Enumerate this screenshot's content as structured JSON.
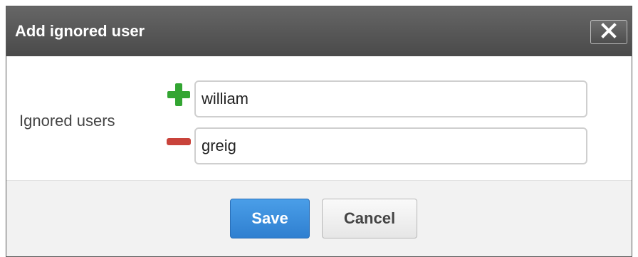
{
  "dialog": {
    "title": "Add ignored user",
    "close_icon": "close-icon"
  },
  "form": {
    "label": "Ignored users",
    "rows": [
      {
        "value": "william",
        "icon": "plus-icon",
        "icon_color": "#33a532"
      },
      {
        "value": "greig",
        "icon": "minus-icon",
        "icon_color": "#c9433b"
      }
    ]
  },
  "footer": {
    "save_label": "Save",
    "cancel_label": "Cancel"
  },
  "colors": {
    "titlebar": "#555555",
    "save_button": "#3a8ddc",
    "add": "#33a532",
    "remove": "#c9433b"
  }
}
